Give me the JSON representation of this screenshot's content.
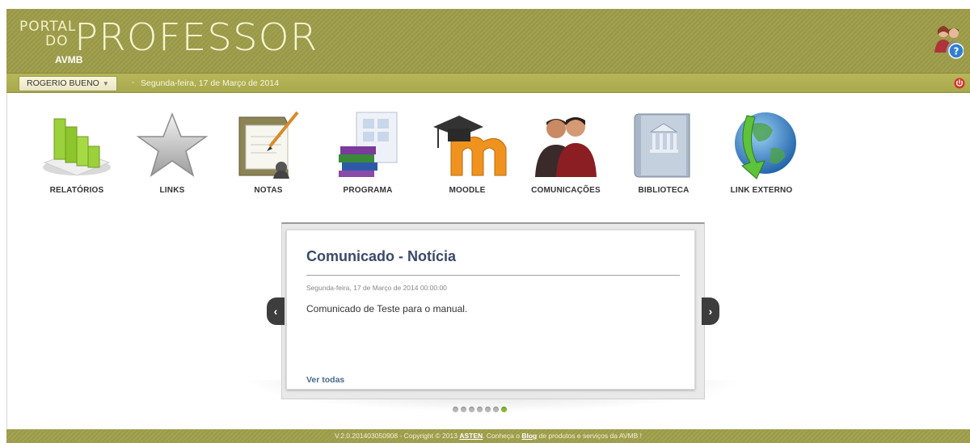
{
  "header": {
    "logo_small_1": "PORTAL",
    "logo_small_2": "DO",
    "logo_big": "PROFESSOR",
    "logo_sub": "AVMB",
    "colors": {
      "header_bg": "#a0a04f",
      "userbar_bg": "#b0b052",
      "footer_bg": "#a3a352"
    }
  },
  "userbar": {
    "user_name": "ROGERIO BUENO",
    "dash": "-",
    "date": "Segunda-feira, 17 de Março de 2014"
  },
  "apps": [
    {
      "label": "RELATÓRIOS",
      "icon": "bar-chart-icon"
    },
    {
      "label": "LINKS",
      "icon": "star-icon"
    },
    {
      "label": "NOTAS",
      "icon": "clipboard-notes-icon"
    },
    {
      "label": "PROGRAMA",
      "icon": "books-icon"
    },
    {
      "label": "MOODLE",
      "icon": "moodle-icon"
    },
    {
      "label": "COMUNICAÇÕES",
      "icon": "people-icon"
    },
    {
      "label": "BIBLIOTECA",
      "icon": "library-book-icon"
    },
    {
      "label": "LINK EXTERNO",
      "icon": "globe-arrow-icon"
    }
  ],
  "news": {
    "title": "Comunicado - Notícia",
    "date": "Segunda-feira, 17 de Março de 2014 00:00:00",
    "body": "Comunicado de Teste para o manual.",
    "more": "Ver todas",
    "prev": "‹",
    "next": "›",
    "dot_count": 7,
    "active_dot": 7
  },
  "footer": {
    "prefix": "V.2.0.201403050908 - Copyright © 2013 ",
    "asten": "ASTEN",
    "middle": ". Conheça o ",
    "blog": "Blog",
    "suffix": " de produtos e serviços da AVMB !"
  }
}
